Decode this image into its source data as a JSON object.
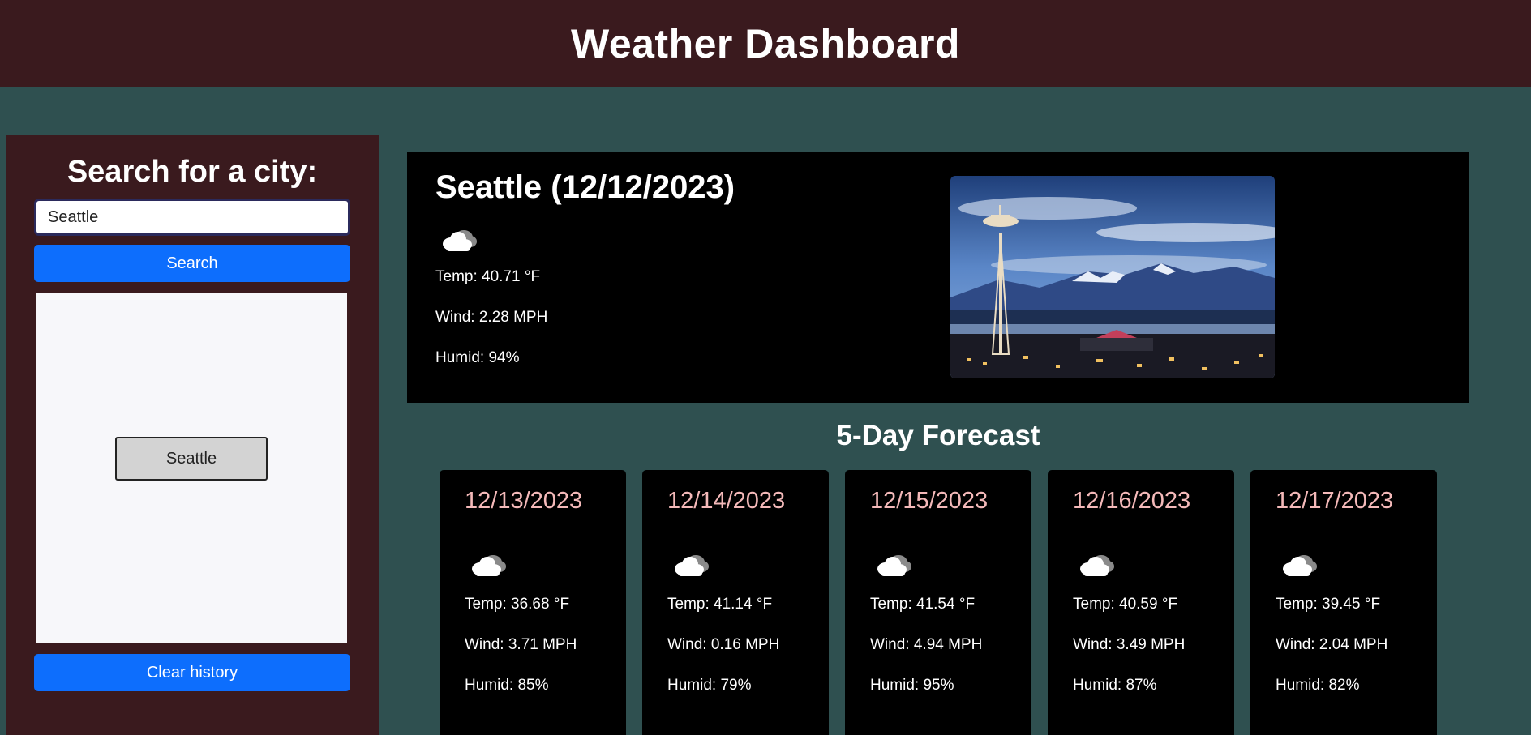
{
  "header": {
    "title": "Weather Dashboard"
  },
  "sidebar": {
    "heading": "Search for a city:",
    "search_value": "Seattle",
    "search_button": "Search",
    "history": [
      "Seattle"
    ],
    "clear_button": "Clear history"
  },
  "current": {
    "title": "Seattle (12/12/2023)",
    "icon": "cloud-icon",
    "temp": "Temp: 40.71 °F",
    "wind": "Wind: 2.28 MPH",
    "humid": "Humid: 94%"
  },
  "forecast": {
    "title": "5-Day Forecast",
    "days": [
      {
        "date": "12/13/2023",
        "icon": "cloud-icon",
        "temp": "Temp: 36.68 °F",
        "wind": "Wind: 3.71 MPH",
        "humid": "Humid: 85%"
      },
      {
        "date": "12/14/2023",
        "icon": "cloud-icon",
        "temp": "Temp: 41.14 °F",
        "wind": "Wind: 0.16 MPH",
        "humid": "Humid: 79%"
      },
      {
        "date": "12/15/2023",
        "icon": "cloud-icon",
        "temp": "Temp: 41.54 °F",
        "wind": "Wind: 4.94 MPH",
        "humid": "Humid: 95%"
      },
      {
        "date": "12/16/2023",
        "icon": "cloud-icon",
        "temp": "Temp: 40.59 °F",
        "wind": "Wind: 3.49 MPH",
        "humid": "Humid: 87%"
      },
      {
        "date": "12/17/2023",
        "icon": "cloud-icon",
        "temp": "Temp: 39.45 °F",
        "wind": "Wind: 2.04 MPH",
        "humid": "Humid: 82%"
      }
    ]
  },
  "colors": {
    "header_bg": "#3a1a1e",
    "page_bg": "#2f5050",
    "button_blue": "#0d6efd",
    "forecast_date": "#f4b9b9"
  }
}
